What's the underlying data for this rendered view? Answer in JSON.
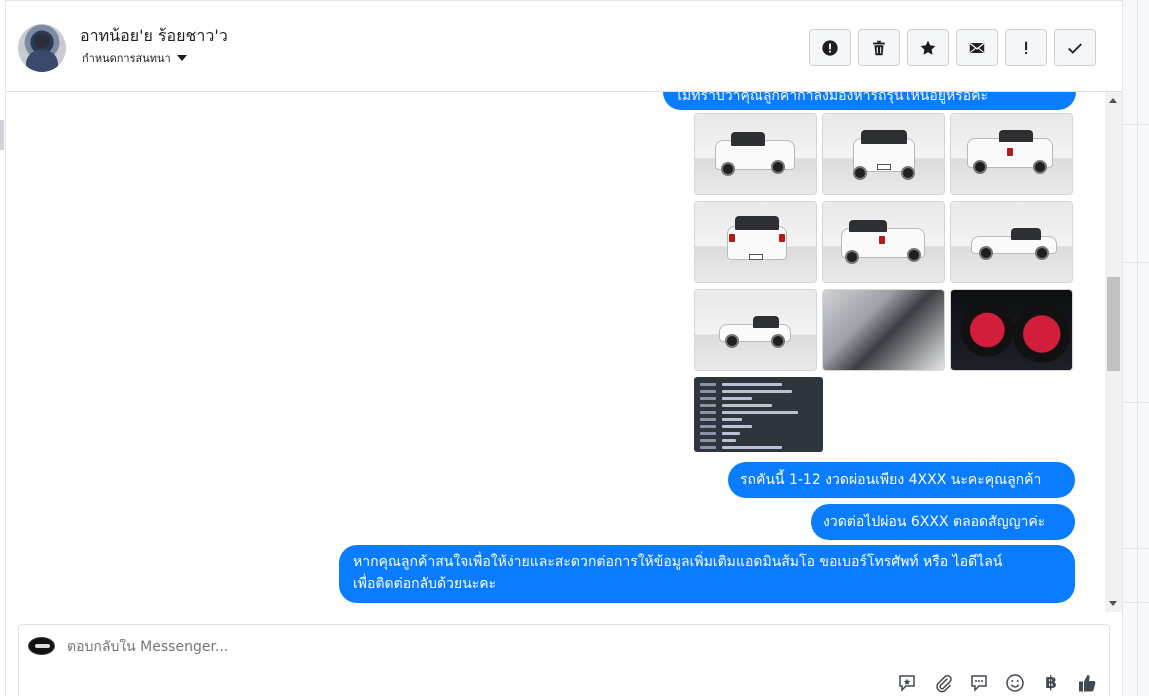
{
  "header": {
    "contact_name": "อาทน้อย'ย ร้อยชาว'ว",
    "subtitle": "กำหนดการสนทนา",
    "actions": [
      {
        "name": "mark-spam-button",
        "icon": "exclamation-circle-icon"
      },
      {
        "name": "delete-button",
        "icon": "trash-icon"
      },
      {
        "name": "star-button",
        "icon": "star-icon"
      },
      {
        "name": "mark-unread-button",
        "icon": "envelope-icon"
      },
      {
        "name": "follow-up-button",
        "icon": "exclamation-icon"
      },
      {
        "name": "mark-done-button",
        "icon": "check-icon"
      }
    ]
  },
  "messages": {
    "cut_top": "ไม่ทราบว่าคุณลูกค้ากำลังมองหารถรุ่นไหนอยู่หรือคะ",
    "installment": "รถคันนี้ 1-12 งวดผ่อนเพียง  4XXX  นะคะคุณลูกค้า",
    "later": "งวดต่อไปผ่อน 6XXX ตลอดสัญญาค่ะ",
    "contact_line1": "หากคุณลูกค้าสนใจเพื่อให้ง่ายและสะดวกต่อการให้ข้อมูลเพิ่มเติมแอดมินส้มโอ ขอเบอร์โทรศัพท์ หรือ ไอดีไลน์",
    "contact_line2": "เพื่อติดต่อกลับด้วยนะคะ"
  },
  "photos": [
    {
      "name": "photo-front-left"
    },
    {
      "name": "photo-front"
    },
    {
      "name": "photo-rear-right"
    },
    {
      "name": "photo-rear"
    },
    {
      "name": "photo-rear-left"
    },
    {
      "name": "photo-side-right"
    },
    {
      "name": "photo-side-right-wide"
    },
    {
      "name": "photo-interior"
    },
    {
      "name": "photo-dashboard"
    },
    {
      "name": "photo-spec-sheet"
    }
  ],
  "composer": {
    "placeholder": "ตอบกลับใน Messenger...",
    "tools": [
      "saved-reply-icon",
      "attachment-icon",
      "comment-icon",
      "emoji-icon",
      "baht-payment-icon",
      "like-icon"
    ],
    "baht_symbol": "฿"
  },
  "colors": {
    "bubble": "#0a7cff",
    "bubble_text": "#ffffff",
    "header_border": "#dddfe2"
  }
}
